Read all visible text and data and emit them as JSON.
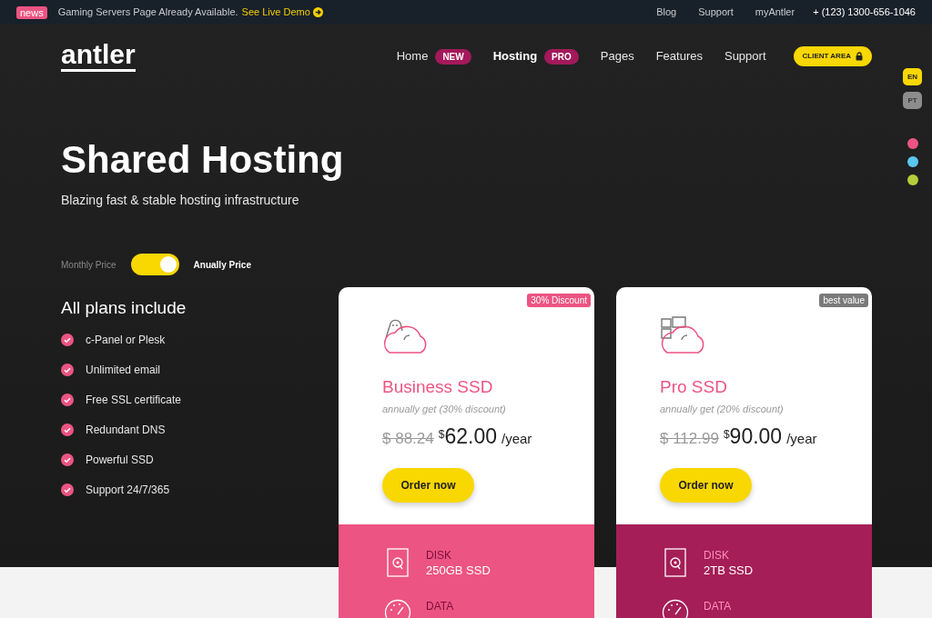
{
  "topbar": {
    "badge": "news",
    "message": "Gaming Servers Page Already Available.",
    "link": "See Live Demo",
    "links": [
      "Blog",
      "Support",
      "myAntler"
    ],
    "phone": "+ (123) 1300-656-1046"
  },
  "header": {
    "logo": "antler",
    "nav": [
      {
        "label": "Home",
        "badge": "NEW",
        "selected": false
      },
      {
        "label": "Hosting",
        "badge": "PRO",
        "selected": true
      },
      {
        "label": "Pages",
        "selected": false
      },
      {
        "label": "Features",
        "selected": false
      },
      {
        "label": "Support",
        "selected": false
      }
    ],
    "client_button": "CLIENT AREA"
  },
  "languages": [
    {
      "label": "EN",
      "selected": true
    },
    {
      "label": "PT",
      "selected": false
    }
  ],
  "color_swatches": [
    {
      "color": "#ec5483"
    },
    {
      "color": "#5bc8ef"
    },
    {
      "color": "#b5cc3b"
    }
  ],
  "hero": {
    "title": "Shared Hosting",
    "subtitle": "Blazing fast & stable hosting infrastructure"
  },
  "price_toggle": {
    "left_label": "Monthly Price",
    "right_label": "Anually Price",
    "on": true
  },
  "includes": {
    "title": "All plans include",
    "items": [
      "c-Panel or Plesk",
      "Unlimited email",
      "Free SSL certificate",
      "Redundant DNS",
      "Powerful SSD",
      "Support 24/7/365"
    ]
  },
  "plans": [
    {
      "kind": "penguin",
      "badge": {
        "text": "30% Discount",
        "color": "#ec5483"
      },
      "name": "Business SSD",
      "note": "annually get (30% discount)",
      "old_price": "$ 88.24",
      "currency": "$",
      "price": "62.00",
      "period": "/year",
      "button": "Order now",
      "color": "#ec5483",
      "features": [
        {
          "kind": "disk",
          "label": "DISK",
          "value": "250GB SSD"
        },
        {
          "kind": "gauge",
          "label": "DATA"
        }
      ]
    },
    {
      "kind": "windows",
      "badge": {
        "text": "best value",
        "color": "#7a7a7a"
      },
      "name": "Pro SSD",
      "note": "annually get (20% discount)",
      "old_price": "$ 112.99",
      "currency": "$",
      "price": "90.00",
      "period": "/year",
      "button": "Order now",
      "color": "#a51e58",
      "features": [
        {
          "kind": "disk",
          "label": "DISK",
          "value": "2TB SSD"
        },
        {
          "kind": "gauge",
          "label": "DATA"
        }
      ]
    }
  ]
}
